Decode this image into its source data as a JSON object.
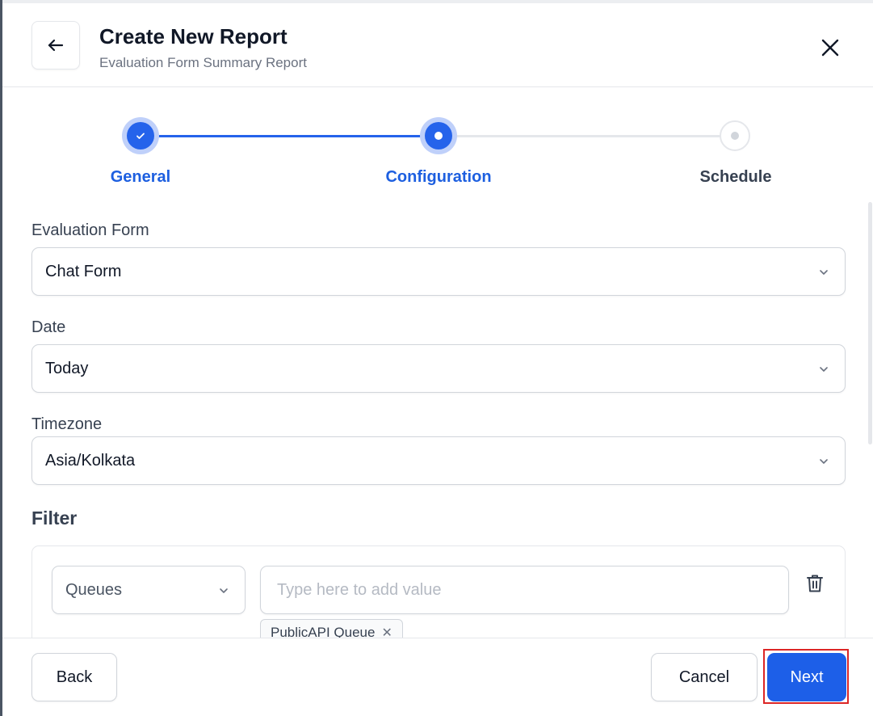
{
  "header": {
    "title": "Create New Report",
    "subtitle": "Evaluation Form Summary Report"
  },
  "stepper": {
    "steps": [
      {
        "label": "General",
        "state": "completed"
      },
      {
        "label": "Configuration",
        "state": "active"
      },
      {
        "label": "Schedule",
        "state": "pending"
      }
    ]
  },
  "form": {
    "evaluation_form": {
      "label": "Evaluation Form",
      "value": "Chat Form"
    },
    "date": {
      "label": "Date",
      "value": "Today"
    },
    "timezone": {
      "label": "Timezone",
      "value": "Asia/Kolkata"
    }
  },
  "filter": {
    "title": "Filter",
    "type_value": "Queues",
    "input_placeholder": "Type here to add value",
    "chips": [
      {
        "label": "PublicAPI Queue"
      }
    ]
  },
  "footer": {
    "back_label": "Back",
    "cancel_label": "Cancel",
    "next_label": "Next"
  },
  "colors": {
    "primary": "#1d5fe8",
    "highlight": "#dc2626"
  }
}
